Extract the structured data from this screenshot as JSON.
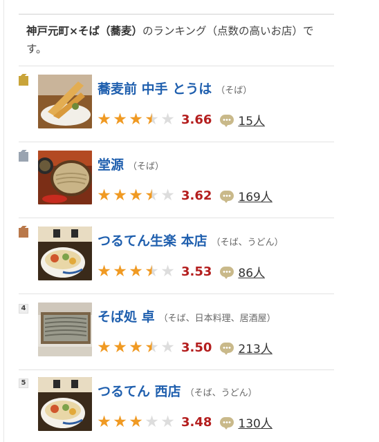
{
  "intro": {
    "bold": "神戸元町×そば（蕎麦）",
    "rest": "のランキング（点数の高いお店）です。"
  },
  "items": [
    {
      "rank": "1",
      "name": "蕎麦前 中手 とうは",
      "genre": "（そば）",
      "stars": 3.5,
      "score": "3.66",
      "reviews": "15人",
      "photo": "tempura-soba"
    },
    {
      "rank": "2",
      "name": "堂源",
      "genre": "（そば）",
      "stars": 3.5,
      "score": "3.62",
      "reviews": "169人",
      "photo": "zaru-soba"
    },
    {
      "rank": "3",
      "name": "つるてん生楽 本店",
      "genre": "（そば、うどん）",
      "stars": 3.5,
      "score": "3.53",
      "reviews": "86人",
      "photo": "donburi-bowl"
    },
    {
      "rank": "4",
      "name": "そば処 卓",
      "genre": "（そば、日本料理、居酒屋）",
      "stars": 3.5,
      "score": "3.50",
      "reviews": "213人",
      "photo": "seiro-soba"
    },
    {
      "rank": "5",
      "name": "つるてん 西店",
      "genre": "（そば、うどん）",
      "stars": 3.0,
      "score": "3.48",
      "reviews": "130人",
      "photo": "donburi-bowl"
    }
  ],
  "colors": {
    "link": "#1f5fae",
    "score": "#b41e1e",
    "star": "#f09a23",
    "star_empty": "#dddddd"
  }
}
